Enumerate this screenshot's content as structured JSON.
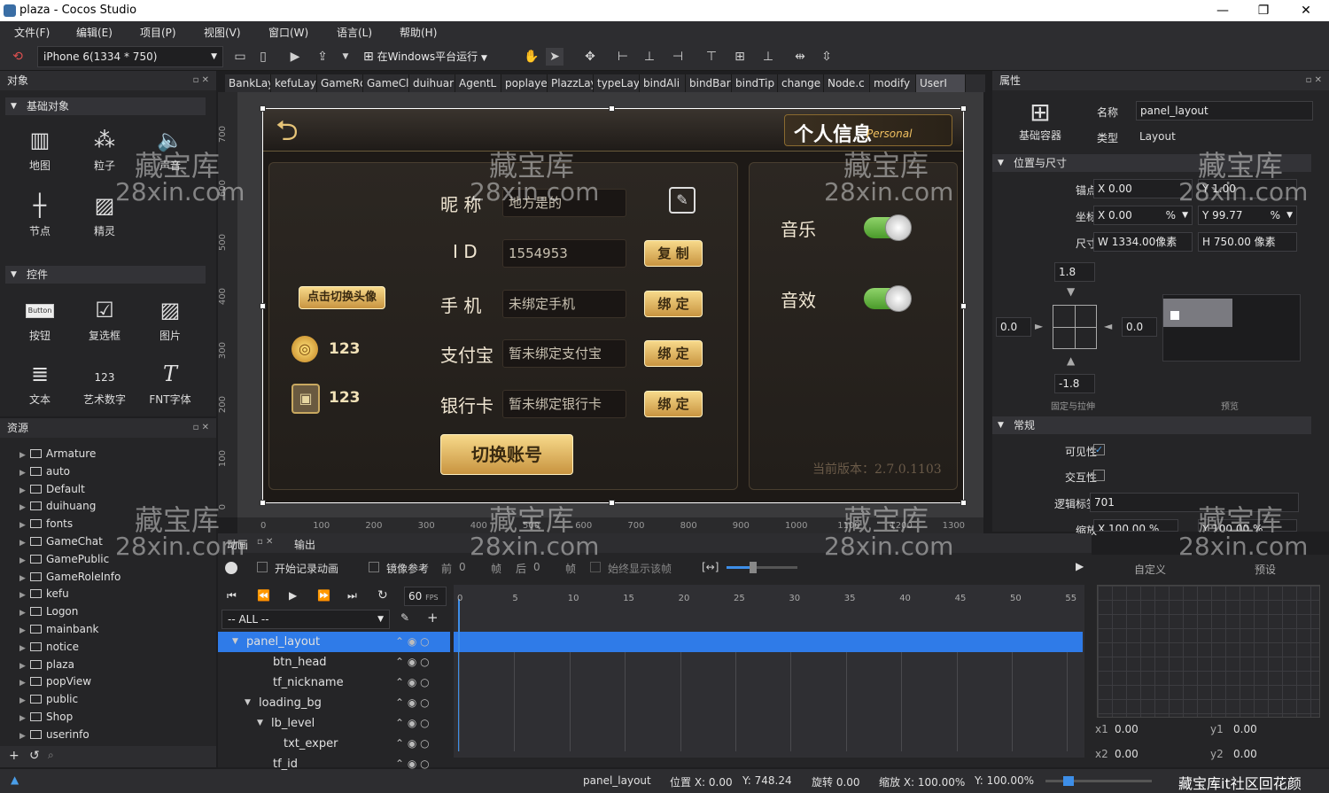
{
  "window": {
    "title": "plaza - Cocos Studio",
    "controls": [
      "—",
      "❐",
      "✕"
    ]
  },
  "menu": [
    "文件(F)",
    "编辑(E)",
    "项目(P)",
    "视图(V)",
    "窗口(W)",
    "语言(L)",
    "帮助(H)"
  ],
  "toolbar": {
    "device": "iPhone 6(1334 * 750)",
    "run_label": "在Windows平台运行"
  },
  "left_panel": {
    "title": "对象",
    "sections": [
      {
        "name": "基础对象",
        "items": [
          {
            "label": "地图",
            "icon": "map-icon"
          },
          {
            "label": "粒子",
            "icon": "particle-icon"
          },
          {
            "label": "声音",
            "icon": "sound-icon"
          },
          {
            "label": "节点",
            "icon": "node-icon"
          },
          {
            "label": "精灵",
            "icon": "sprite-icon"
          }
        ]
      },
      {
        "name": "控件",
        "items": [
          {
            "label": "按钮",
            "icon": "button-icon"
          },
          {
            "label": "复选框",
            "icon": "checkbox-icon"
          },
          {
            "label": "图片",
            "icon": "image-icon"
          },
          {
            "label": "文本",
            "icon": "text-icon"
          },
          {
            "label": "艺术数字",
            "icon": "art-number-icon"
          },
          {
            "label": "FNT字体",
            "icon": "fnt-font-icon"
          }
        ]
      }
    ],
    "button_icon_text": "Button",
    "art_number_icon_text": "123"
  },
  "resources": {
    "title": "资源",
    "folders": [
      "Armature",
      "auto",
      "Default",
      "duihuang",
      "fonts",
      "GameChat",
      "GamePublic",
      "GameRoleInfo",
      "kefu",
      "Logon",
      "mainbank",
      "notice",
      "plaza",
      "popView",
      "public",
      "Shop",
      "userinfo"
    ],
    "footer": [
      "+",
      "↺",
      "⌕"
    ]
  },
  "tabs": [
    "BankLay",
    "kefuLay",
    "GameRc",
    "GameCl",
    "duihuar",
    "AgentL",
    "poplaye",
    "PlazzLay",
    "typeLay",
    "bindAli",
    "bindBar",
    "bindTip",
    "change",
    "Node.c",
    "modify",
    "UserI"
  ],
  "ruler": {
    "v": [
      "700",
      "600",
      "500",
      "400",
      "300",
      "200",
      "100",
      "0"
    ],
    "h": [
      "0",
      "100",
      "200",
      "300",
      "400",
      "500",
      "600",
      "700",
      "800",
      "900",
      "1000",
      "1100",
      "1200",
      "1300"
    ]
  },
  "game": {
    "title_badge": "个人信息",
    "title_badge_sub": "Personal",
    "change_avatar": "点击切换头像",
    "coins": "123",
    "bank": "123",
    "rows": [
      {
        "label": "昵  称",
        "value": "地方是的",
        "button": ""
      },
      {
        "label": "I  D",
        "value": "1554953",
        "button": "复 制"
      },
      {
        "label": "手  机",
        "value": "未绑定手机",
        "button": "绑 定"
      },
      {
        "label": "支付宝",
        "value": "暂未绑定支付宝",
        "button": "绑 定"
      },
      {
        "label": "银行卡",
        "value": "暂未绑定银行卡",
        "button": "绑 定"
      }
    ],
    "switch_account": "切换账号",
    "music": "音乐",
    "sfx": "音效",
    "version": "当前版本：2.7.0.1103"
  },
  "properties": {
    "title": "属性",
    "container_label": "基础容器",
    "name_label": "名称",
    "name_value": "panel_layout",
    "type_label": "类型",
    "type_value": "Layout",
    "pos_size_header": "位置与尺寸",
    "anchor_label": "锚点",
    "anchor_x": "0.00",
    "anchor_y": "1.00",
    "pos_label": "坐标",
    "pos_x": "0.00",
    "pos_x_unit": "%",
    "pos_y": "99.77",
    "pos_y_unit": "%",
    "size_label": "尺寸",
    "size_w": "1334.00像素",
    "size_h": "750.00 像素",
    "margin_top": "1.8",
    "margin_left": "0.0",
    "margin_right": "0.0",
    "margin_bottom": "-1.8",
    "stretch_label": "固定与拉伸",
    "preview_label": "预览",
    "general_header": "常规",
    "visible_label": "可见性",
    "interactive_label": "交互性",
    "tag_label": "逻辑标签",
    "tag_value": "701",
    "scale_label": "缩放",
    "scale_x": "100.00",
    "scale_unit": "%",
    "scale_y": "100.00"
  },
  "animation": {
    "tabs": [
      "动画",
      "输出"
    ],
    "record": "开始记录动画",
    "mirror": "镜像参考",
    "prev_label": "前",
    "prev_val": "0",
    "prev_unit": "帧",
    "next_label": "后",
    "next_val": "0",
    "next_unit": "帧",
    "always_show": "始终显示该帧",
    "fps": "60",
    "fps_unit": "FPS",
    "filter": "-- ALL --",
    "ticks": [
      "0",
      "5",
      "10",
      "15",
      "20",
      "25",
      "30",
      "35",
      "40",
      "45",
      "50",
      "55"
    ],
    "nodes": [
      {
        "name": "panel_layout",
        "level": 0,
        "selected": true,
        "caret": "▼"
      },
      {
        "name": "btn_head",
        "level": 1,
        "selected": false,
        "caret": ""
      },
      {
        "name": "tf_nickname",
        "level": 1,
        "selected": false,
        "caret": ""
      },
      {
        "name": "loading_bg",
        "level": 1,
        "selected": false,
        "caret": "▼"
      },
      {
        "name": "lb_level",
        "level": 2,
        "selected": false,
        "caret": "▼"
      },
      {
        "name": "txt_exper",
        "level": 3,
        "selected": false,
        "caret": ""
      },
      {
        "name": "tf_id",
        "level": 1,
        "selected": false,
        "caret": ""
      }
    ],
    "curve_tabs": [
      "自定义",
      "预设"
    ],
    "x1": "0.00",
    "y1": "0.00",
    "x2": "0.00",
    "y2": "0.00"
  },
  "status": {
    "node": "panel_layout",
    "pos": "位置 X: 0.00",
    "pos_y": "Y: 748.24",
    "rot": "旋转 0.00",
    "scale": "缩放 X: 100.00%",
    "scale_y": "Y: 100.00%"
  },
  "watermark": {
    "line1": "藏宝库",
    "line2": "28xin.com",
    "corner": "藏宝库it社区回花颜"
  }
}
